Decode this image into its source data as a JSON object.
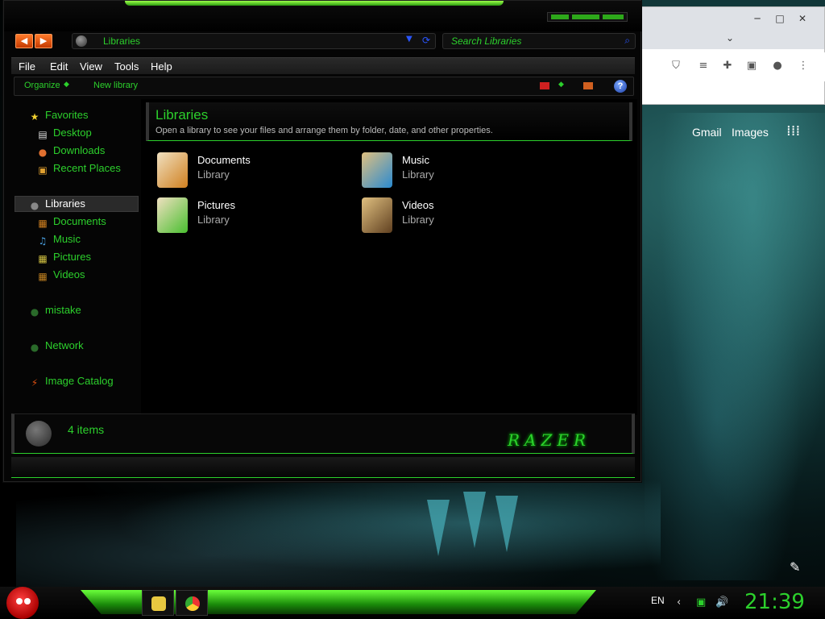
{
  "explorer": {
    "address": "Libraries",
    "search_placeholder": "Search Libraries",
    "menu": [
      "File",
      "Edit",
      "View",
      "Tools",
      "Help"
    ],
    "commands": {
      "organize": "Organize",
      "new_library": "New library"
    },
    "nav": {
      "favorites": "Favorites",
      "favorites_items": [
        "Desktop",
        "Downloads",
        "Recent Places"
      ],
      "libraries": "Libraries",
      "libraries_items": [
        "Documents",
        "Music",
        "Pictures",
        "Videos"
      ],
      "other": [
        "mistake",
        "Network",
        "Image Catalog"
      ]
    },
    "header": {
      "title": "Libraries",
      "subtitle": "Open a library to see your files and arrange them by folder, date, and other properties."
    },
    "items": [
      {
        "name": "Documents",
        "kind": "Library",
        "color": "#d08020"
      },
      {
        "name": "Music",
        "kind": "Library",
        "color": "#2a8ad0"
      },
      {
        "name": "Pictures",
        "kind": "Library",
        "color": "#4abf30"
      },
      {
        "name": "Videos",
        "kind": "Library",
        "color": "#a06020"
      }
    ],
    "status": {
      "count": "4 items",
      "logo": "RAZER"
    },
    "help_glyph": "?"
  },
  "browser": {
    "links": {
      "gmail": "Gmail",
      "images": "Images"
    }
  },
  "taskbar": {
    "lang": "EN",
    "clock": "21:39"
  },
  "colors": {
    "accent": "#2cd02c",
    "nav_blue": "#2a56ff",
    "nav_orange": "#e05010"
  }
}
